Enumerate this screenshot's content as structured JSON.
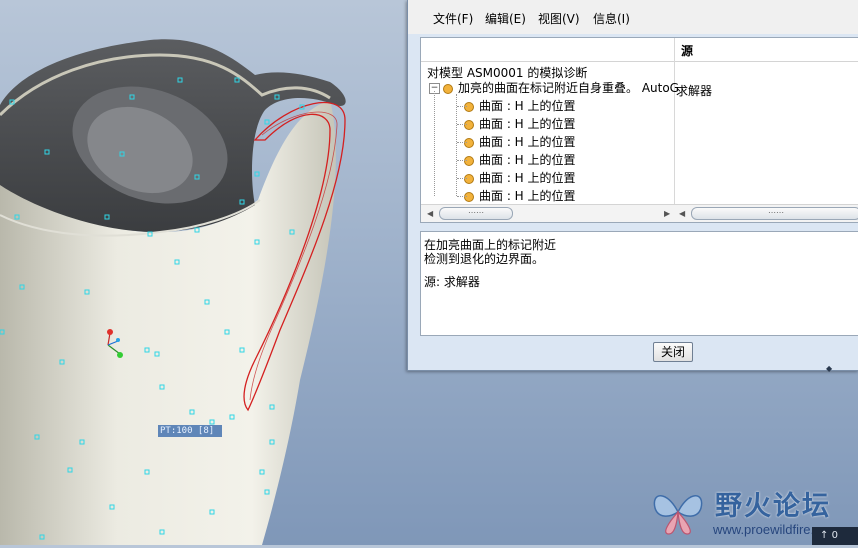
{
  "menu": {
    "file": "文件(F)",
    "edit": "编辑(E)",
    "view": "视图(V)",
    "info": "信息(I)"
  },
  "tree": {
    "column_source": "源",
    "root_label": "对模型 ASM0001 的模拟诊断",
    "error_item": "加亮的曲面在标记附近自身重叠。 AutoG",
    "error_source": "求解器",
    "children": [
      "曲面 : H 上的位置",
      "曲面 : H 上的位置",
      "曲面 : H 上的位置",
      "曲面 : H 上的位置",
      "曲面 : H 上的位置",
      "曲面 : H 上的位置"
    ],
    "scroll_thumb_left": "⋯⋯",
    "scroll_thumb_right": "⋯⋯"
  },
  "message": {
    "line1": "在加亮曲面上的标记附近",
    "line2": "检测到退化的边界面。",
    "line3": "源: 求解器"
  },
  "buttons": {
    "close": "关闭"
  },
  "viewport": {
    "point_label": "PT:100 [8]"
  },
  "watermark": {
    "title": "野火论坛",
    "url": "www.proewildfire.cn"
  },
  "taskbar": {
    "clock_fragment": "0"
  },
  "colors": {
    "highlight_curve": "#d42020",
    "marker": "#2fd6e6",
    "dialog_bg": "#dbe6f3",
    "model_surface": "#ecebe2"
  }
}
